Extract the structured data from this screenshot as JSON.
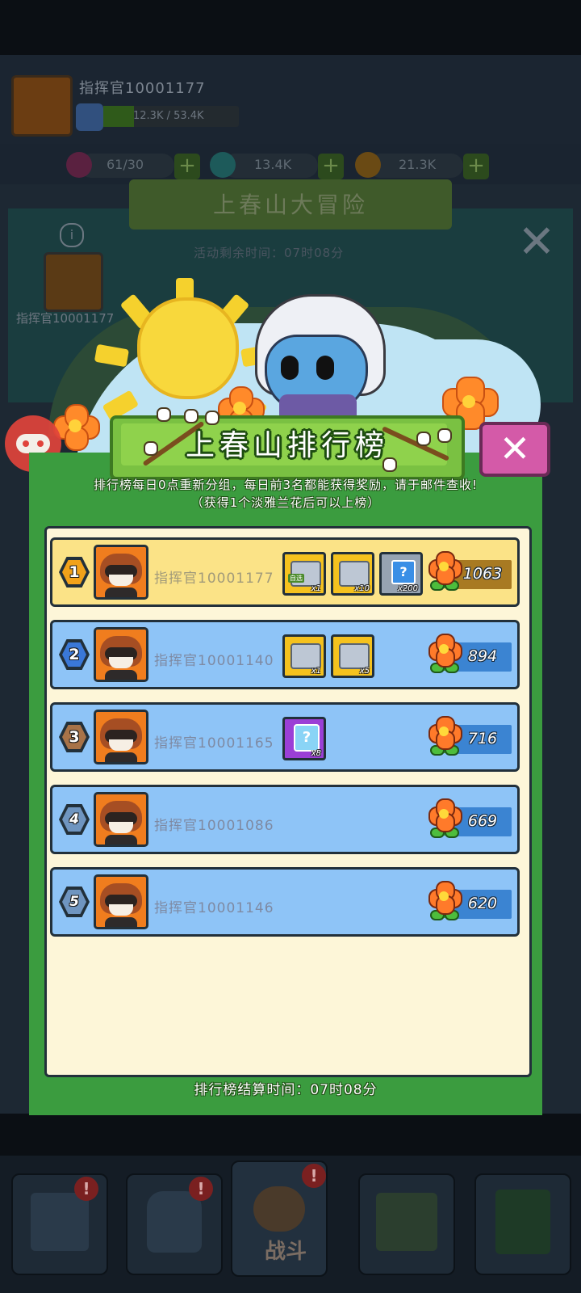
{
  "background": {
    "player_name": "指挥官10001177",
    "level": "58",
    "xp": "12.3K / 53.4K",
    "resources": [
      {
        "name": "energy",
        "icon": "energy-icon",
        "value": "61/30"
      },
      {
        "name": "gems",
        "icon": "diamond-icon",
        "value": "13.4K"
      },
      {
        "name": "coins",
        "icon": "coin-icon",
        "value": "21.3K"
      }
    ],
    "stage_title": "上春山大冒险",
    "event_timer": "活动剩余时间：07时08分",
    "profile_name": "指挥官10001177",
    "nav_items": [
      {
        "name": "shop",
        "icon": "shop-icon",
        "badge": "!"
      },
      {
        "name": "equipment",
        "icon": "armor-icon",
        "badge": "!"
      },
      {
        "name": "battle",
        "icon": "battle-icon",
        "label": "战斗",
        "badge": "!"
      },
      {
        "name": "map",
        "icon": "map-icon"
      },
      {
        "name": "upgrade",
        "icon": "upgrade-icon"
      }
    ]
  },
  "leaderboard": {
    "title": "上春山排行榜",
    "rules_line1": "排行榜每日0点重新分组，每日前3名都能获得奖励，请于邮件查收!",
    "rules_line2": "（获得1个淡雅兰花后可以上榜）",
    "close_label": "✕",
    "settlement": "排行榜结算时间：07时08分",
    "rows": [
      {
        "rank": "1",
        "name": "指挥官10001177",
        "score": "1063",
        "rewards": [
          {
            "type": "gold-chest",
            "qty": "x1",
            "tag": "自选"
          },
          {
            "type": "gold-chest",
            "qty": "x10"
          },
          {
            "type": "silver-card",
            "qty": "x200"
          }
        ]
      },
      {
        "rank": "2",
        "name": "指挥官10001140",
        "score": "894",
        "rewards": [
          {
            "type": "gold-chest",
            "qty": "x1"
          },
          {
            "type": "gold-chest",
            "qty": "x5"
          }
        ]
      },
      {
        "rank": "3",
        "name": "指挥官10001165",
        "score": "716",
        "rewards": [
          {
            "type": "purple-card",
            "qty": "x8"
          }
        ]
      },
      {
        "rank": "4",
        "name": "指挥官10001086",
        "score": "669",
        "rewards": []
      },
      {
        "rank": "5",
        "name": "指挥官10001146",
        "score": "620",
        "rewards": []
      }
    ]
  },
  "colors": {
    "panel_green": "#3b9c3f",
    "row_gold": "#fbe387",
    "row_blue": "#8ec4f7",
    "close_pink": "#d45aa8",
    "rank1": "#f2a21a",
    "rank2": "#3a78d8",
    "rank3": "#a87348",
    "rank_other": "#6f95c0"
  }
}
